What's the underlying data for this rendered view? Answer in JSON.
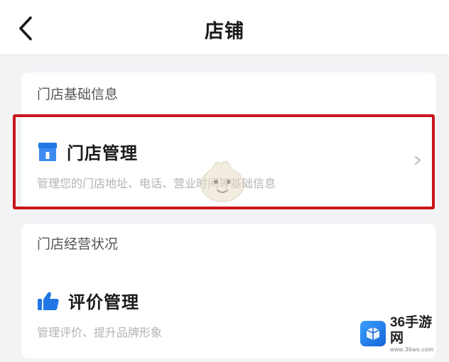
{
  "header": {
    "title": "店铺",
    "back_icon": "chevron-left-icon"
  },
  "sections": [
    {
      "title": "门店基础信息",
      "items": [
        {
          "icon": "store-icon",
          "title": "门店管理",
          "description": "管理您的门店地址、电话、营业时间等基础信息",
          "highlighted": true
        }
      ]
    },
    {
      "title": "门店经营状况",
      "items": [
        {
          "icon": "thumbs-up-icon",
          "title": "评价管理",
          "description": "管理评价、提升品牌形象"
        }
      ]
    }
  ],
  "colors": {
    "highlight_border": "#c8161d",
    "icon_blue": "#2277e6",
    "background": "#f2f3f5"
  },
  "watermark": {
    "brand": "36手游网",
    "url": "www.36wo.com"
  }
}
